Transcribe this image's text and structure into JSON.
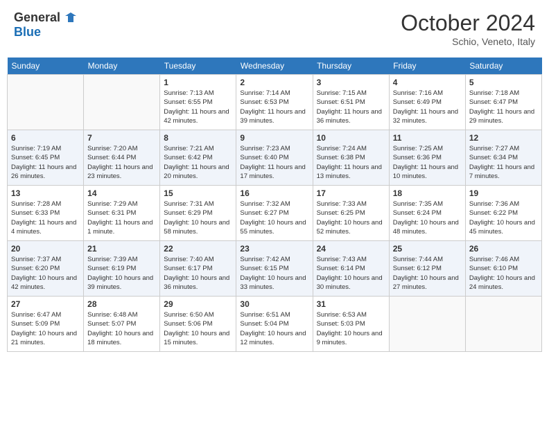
{
  "header": {
    "logo_general": "General",
    "logo_blue": "Blue",
    "month_title": "October 2024",
    "location": "Schio, Veneto, Italy"
  },
  "weekdays": [
    "Sunday",
    "Monday",
    "Tuesday",
    "Wednesday",
    "Thursday",
    "Friday",
    "Saturday"
  ],
  "weeks": [
    [
      {
        "day": "",
        "info": ""
      },
      {
        "day": "",
        "info": ""
      },
      {
        "day": "1",
        "info": "Sunrise: 7:13 AM\nSunset: 6:55 PM\nDaylight: 11 hours and 42 minutes."
      },
      {
        "day": "2",
        "info": "Sunrise: 7:14 AM\nSunset: 6:53 PM\nDaylight: 11 hours and 39 minutes."
      },
      {
        "day": "3",
        "info": "Sunrise: 7:15 AM\nSunset: 6:51 PM\nDaylight: 11 hours and 36 minutes."
      },
      {
        "day": "4",
        "info": "Sunrise: 7:16 AM\nSunset: 6:49 PM\nDaylight: 11 hours and 32 minutes."
      },
      {
        "day": "5",
        "info": "Sunrise: 7:18 AM\nSunset: 6:47 PM\nDaylight: 11 hours and 29 minutes."
      }
    ],
    [
      {
        "day": "6",
        "info": "Sunrise: 7:19 AM\nSunset: 6:45 PM\nDaylight: 11 hours and 26 minutes."
      },
      {
        "day": "7",
        "info": "Sunrise: 7:20 AM\nSunset: 6:44 PM\nDaylight: 11 hours and 23 minutes."
      },
      {
        "day": "8",
        "info": "Sunrise: 7:21 AM\nSunset: 6:42 PM\nDaylight: 11 hours and 20 minutes."
      },
      {
        "day": "9",
        "info": "Sunrise: 7:23 AM\nSunset: 6:40 PM\nDaylight: 11 hours and 17 minutes."
      },
      {
        "day": "10",
        "info": "Sunrise: 7:24 AM\nSunset: 6:38 PM\nDaylight: 11 hours and 13 minutes."
      },
      {
        "day": "11",
        "info": "Sunrise: 7:25 AM\nSunset: 6:36 PM\nDaylight: 11 hours and 10 minutes."
      },
      {
        "day": "12",
        "info": "Sunrise: 7:27 AM\nSunset: 6:34 PM\nDaylight: 11 hours and 7 minutes."
      }
    ],
    [
      {
        "day": "13",
        "info": "Sunrise: 7:28 AM\nSunset: 6:33 PM\nDaylight: 11 hours and 4 minutes."
      },
      {
        "day": "14",
        "info": "Sunrise: 7:29 AM\nSunset: 6:31 PM\nDaylight: 11 hours and 1 minute."
      },
      {
        "day": "15",
        "info": "Sunrise: 7:31 AM\nSunset: 6:29 PM\nDaylight: 10 hours and 58 minutes."
      },
      {
        "day": "16",
        "info": "Sunrise: 7:32 AM\nSunset: 6:27 PM\nDaylight: 10 hours and 55 minutes."
      },
      {
        "day": "17",
        "info": "Sunrise: 7:33 AM\nSunset: 6:25 PM\nDaylight: 10 hours and 52 minutes."
      },
      {
        "day": "18",
        "info": "Sunrise: 7:35 AM\nSunset: 6:24 PM\nDaylight: 10 hours and 48 minutes."
      },
      {
        "day": "19",
        "info": "Sunrise: 7:36 AM\nSunset: 6:22 PM\nDaylight: 10 hours and 45 minutes."
      }
    ],
    [
      {
        "day": "20",
        "info": "Sunrise: 7:37 AM\nSunset: 6:20 PM\nDaylight: 10 hours and 42 minutes."
      },
      {
        "day": "21",
        "info": "Sunrise: 7:39 AM\nSunset: 6:19 PM\nDaylight: 10 hours and 39 minutes."
      },
      {
        "day": "22",
        "info": "Sunrise: 7:40 AM\nSunset: 6:17 PM\nDaylight: 10 hours and 36 minutes."
      },
      {
        "day": "23",
        "info": "Sunrise: 7:42 AM\nSunset: 6:15 PM\nDaylight: 10 hours and 33 minutes."
      },
      {
        "day": "24",
        "info": "Sunrise: 7:43 AM\nSunset: 6:14 PM\nDaylight: 10 hours and 30 minutes."
      },
      {
        "day": "25",
        "info": "Sunrise: 7:44 AM\nSunset: 6:12 PM\nDaylight: 10 hours and 27 minutes."
      },
      {
        "day": "26",
        "info": "Sunrise: 7:46 AM\nSunset: 6:10 PM\nDaylight: 10 hours and 24 minutes."
      }
    ],
    [
      {
        "day": "27",
        "info": "Sunrise: 6:47 AM\nSunset: 5:09 PM\nDaylight: 10 hours and 21 minutes."
      },
      {
        "day": "28",
        "info": "Sunrise: 6:48 AM\nSunset: 5:07 PM\nDaylight: 10 hours and 18 minutes."
      },
      {
        "day": "29",
        "info": "Sunrise: 6:50 AM\nSunset: 5:06 PM\nDaylight: 10 hours and 15 minutes."
      },
      {
        "day": "30",
        "info": "Sunrise: 6:51 AM\nSunset: 5:04 PM\nDaylight: 10 hours and 12 minutes."
      },
      {
        "day": "31",
        "info": "Sunrise: 6:53 AM\nSunset: 5:03 PM\nDaylight: 10 hours and 9 minutes."
      },
      {
        "day": "",
        "info": ""
      },
      {
        "day": "",
        "info": ""
      }
    ]
  ]
}
